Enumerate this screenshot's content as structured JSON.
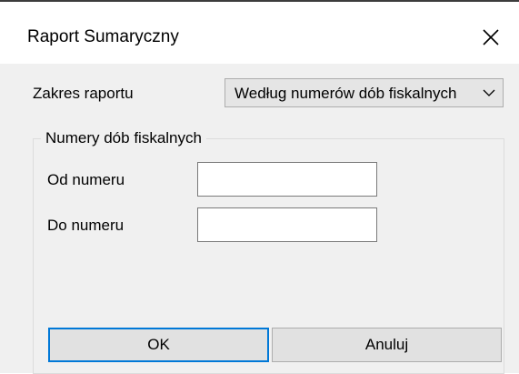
{
  "window": {
    "title": "Raport Sumaryczny"
  },
  "report_range": {
    "label": "Zakres raportu",
    "selected": "Według numerów dób fiskalnych"
  },
  "group": {
    "title": "Numery dób fiskalnych",
    "from_label": "Od numeru",
    "from_value": "",
    "to_label": "Do numeru",
    "to_value": ""
  },
  "buttons": {
    "ok": "OK",
    "cancel": "Anuluj"
  },
  "icons": {
    "close": "close-icon",
    "dropdown": "chevron-down-icon"
  },
  "colors": {
    "focus_border": "#0078d7",
    "client_bg": "#f0f0f0"
  }
}
